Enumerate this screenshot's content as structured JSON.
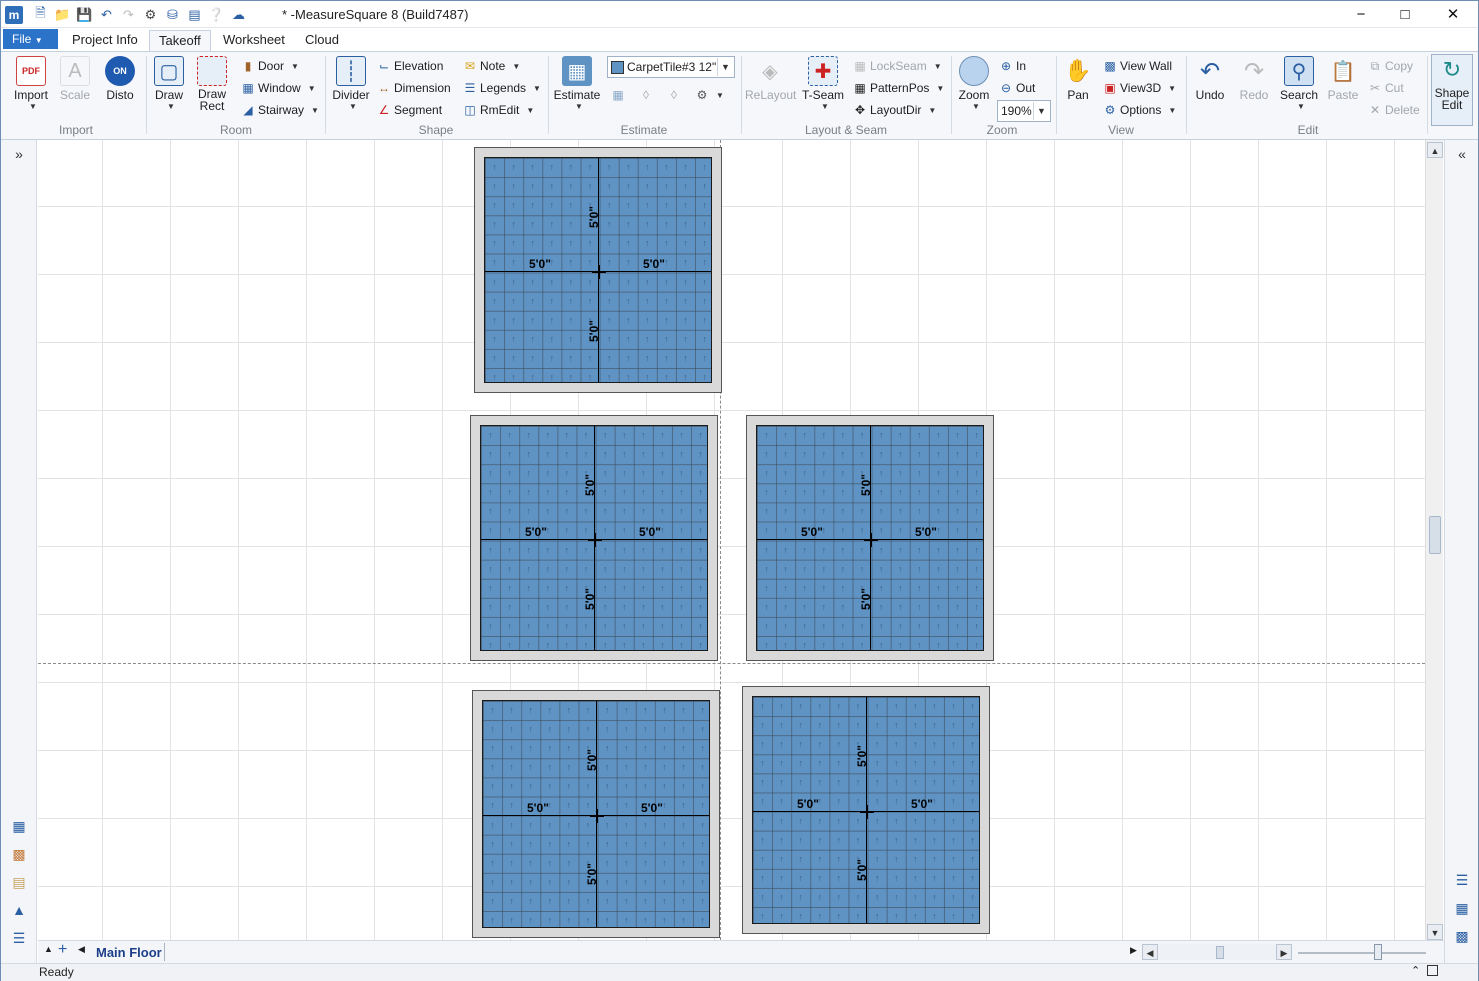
{
  "window": {
    "title": "* -MeasureSquare 8 (Build7487)",
    "logo": "m",
    "minimize": "−",
    "maximize": "□",
    "close": "✕"
  },
  "qat": [
    "new-doc-icon",
    "open-folder-icon",
    "save-icon",
    "undo-icon",
    "redo-icon",
    "settings-gear-icon",
    "database-icon",
    "layout-icon",
    "help-icon",
    "cloud-icon"
  ],
  "tabs": {
    "file": "File",
    "items": [
      {
        "label": "Project Info",
        "active": false
      },
      {
        "label": "Takeoff",
        "active": true
      },
      {
        "label": "Worksheet",
        "active": false
      },
      {
        "label": "Cloud",
        "active": false
      }
    ]
  },
  "ribbon": {
    "import": {
      "label": "Import",
      "import": "Import",
      "scale": "Scale",
      "disto": "Disto"
    },
    "room": {
      "label": "Room",
      "draw": "Draw",
      "draw_rect_1": "Draw",
      "draw_rect_2": "Rect",
      "door": "Door",
      "window": "Window",
      "stairway": "Stairway"
    },
    "shape": {
      "label": "Shape",
      "divider": "Divider",
      "elevation": "Elevation",
      "dimension": "Dimension",
      "segment": "Segment",
      "note": "Note",
      "legends": "Legends",
      "rmedit": "RmEdit"
    },
    "estimate": {
      "label": "Estimate",
      "estimate": "Estimate",
      "product": "CarpetTile#3 12\""
    },
    "layout": {
      "label": "Layout & Seam",
      "relayout": "ReLayout",
      "tseam": "T-Seam",
      "lockseam": "LockSeam",
      "patternpos": "PatternPos",
      "layoutdir": "LayoutDir"
    },
    "zoom": {
      "label": "Zoom",
      "zoom": "Zoom",
      "in": "In",
      "out": "Out",
      "level": "190%"
    },
    "view": {
      "label": "View",
      "pan": "Pan",
      "view_wall": "View Wall",
      "view3d": "View3D",
      "options": "Options"
    },
    "edit": {
      "label": "Edit",
      "undo": "Undo",
      "redo": "Redo",
      "search": "Search",
      "paste": "Paste",
      "copy": "Copy",
      "cut": "Cut",
      "delete": "Delete"
    },
    "shape_edit": {
      "line1": "Shape",
      "line2": "Edit"
    }
  },
  "rooms": [
    {
      "h_left": "5'0\"",
      "h_right": "5'0\"",
      "v_top": "5'0\"",
      "v_bottom": "5'0\""
    },
    {
      "h_left": "5'0\"",
      "h_right": "5'0\"",
      "v_top": "5'0\"",
      "v_bottom": "5'0\""
    },
    {
      "h_left": "5'0\"",
      "h_right": "5'0\"",
      "v_top": "5'0\"",
      "v_bottom": "5'0\""
    },
    {
      "h_left": "5'0\"",
      "h_right": "5'0\"",
      "v_top": "5'0\"",
      "v_bottom": "5'0\""
    },
    {
      "h_left": "5'0\"",
      "h_right": "5'0\"",
      "v_top": "5'0\"",
      "v_bottom": "5'0\""
    }
  ],
  "panels": {
    "expand_left": "»",
    "expand_right": "«"
  },
  "floor_tab": "Main Floor",
  "status": "Ready",
  "colors": {
    "tile": "#5f93c4",
    "room_border": "#d9d9d9",
    "accent": "#2b72c9"
  }
}
